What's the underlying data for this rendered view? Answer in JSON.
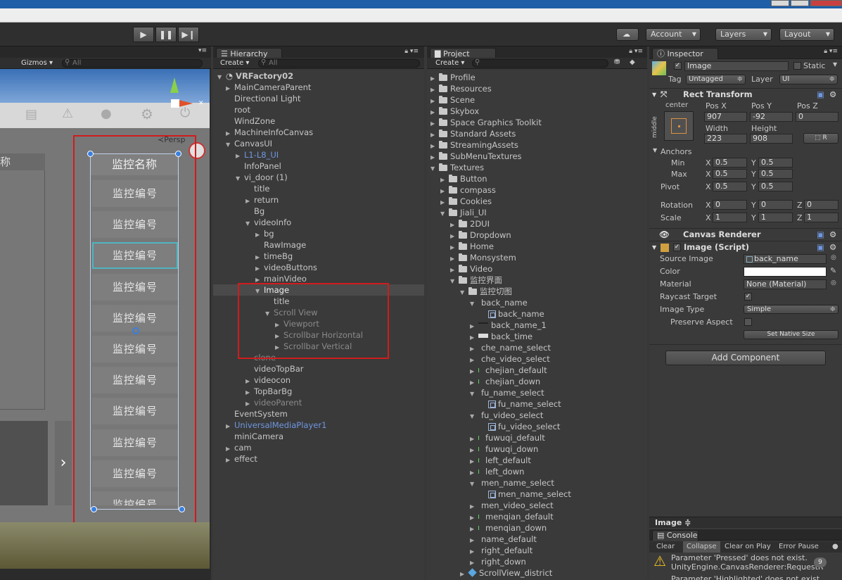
{
  "toolbar": {
    "account": "Account",
    "layers": "Layers",
    "layout": "Layout"
  },
  "scene": {
    "gizmos": "Gizmos",
    "search_placeholder": "All",
    "persp": "Persp",
    "left_header": "称",
    "panel_title": "监控名称",
    "items": [
      "监控编号",
      "监控编号",
      "监控编号",
      "监控编号",
      "监控编号",
      "监控编号",
      "监控编号",
      "监控编号",
      "监控编号",
      "监控编号",
      "监控编号"
    ]
  },
  "hierarchy": {
    "tab": "Hierarchy",
    "create": "Create",
    "search_placeholder": "All",
    "root": "VRFactory02",
    "rows": [
      {
        "label": "MainCameraParent",
        "indent": 1,
        "arrow": "▶",
        "style": ""
      },
      {
        "label": "Directional Light",
        "indent": 1,
        "arrow": "",
        "style": ""
      },
      {
        "label": "root",
        "indent": 1,
        "arrow": "",
        "style": ""
      },
      {
        "label": "WindZone",
        "indent": 1,
        "arrow": "",
        "style": ""
      },
      {
        "label": "MachineInfoCanvas",
        "indent": 1,
        "arrow": "▶",
        "style": ""
      },
      {
        "label": "CanvasUI",
        "indent": 1,
        "arrow": "▼",
        "style": ""
      },
      {
        "label": "L1-L8_UI",
        "indent": 2,
        "arrow": "▶",
        "style": "blue"
      },
      {
        "label": "InfoPanel",
        "indent": 2,
        "arrow": "",
        "style": ""
      },
      {
        "label": "vi_door (1)",
        "indent": 2,
        "arrow": "▼",
        "style": ""
      },
      {
        "label": "title",
        "indent": 3,
        "arrow": "",
        "style": ""
      },
      {
        "label": "return",
        "indent": 3,
        "arrow": "▶",
        "style": ""
      },
      {
        "label": "Bg",
        "indent": 3,
        "arrow": "",
        "style": ""
      },
      {
        "label": "videoInfo",
        "indent": 3,
        "arrow": "▼",
        "style": ""
      },
      {
        "label": "bg",
        "indent": 4,
        "arrow": "▶",
        "style": ""
      },
      {
        "label": "RawImage",
        "indent": 4,
        "arrow": "",
        "style": ""
      },
      {
        "label": "timeBg",
        "indent": 4,
        "arrow": "▶",
        "style": ""
      },
      {
        "label": "videoButtons",
        "indent": 4,
        "arrow": "▶",
        "style": ""
      },
      {
        "label": "mainVideo",
        "indent": 4,
        "arrow": "▶",
        "style": ""
      },
      {
        "label": "Image",
        "indent": 4,
        "arrow": "▼",
        "style": "sel"
      },
      {
        "label": "title",
        "indent": 5,
        "arrow": "",
        "style": ""
      },
      {
        "label": "Scroll View",
        "indent": 5,
        "arrow": "▼",
        "style": "gray"
      },
      {
        "label": "Viewport",
        "indent": 6,
        "arrow": "▶",
        "style": "gray"
      },
      {
        "label": "Scrollbar Horizontal",
        "indent": 6,
        "arrow": "▶",
        "style": "gray"
      },
      {
        "label": "Scrollbar Vertical",
        "indent": 6,
        "arrow": "▶",
        "style": "gray"
      },
      {
        "label": "clone",
        "indent": 3,
        "arrow": "",
        "style": "gray"
      },
      {
        "label": "videoTopBar",
        "indent": 3,
        "arrow": "",
        "style": ""
      },
      {
        "label": "videocon",
        "indent": 3,
        "arrow": "▶",
        "style": ""
      },
      {
        "label": "TopBarBg",
        "indent": 3,
        "arrow": "▶",
        "style": ""
      },
      {
        "label": "videoParent",
        "indent": 3,
        "arrow": "▶",
        "style": "gray"
      },
      {
        "label": "EventSystem",
        "indent": 1,
        "arrow": "",
        "style": ""
      },
      {
        "label": "UniversalMediaPlayer1",
        "indent": 1,
        "arrow": "▶",
        "style": "blue"
      },
      {
        "label": "miniCamera",
        "indent": 1,
        "arrow": "",
        "style": ""
      },
      {
        "label": "cam",
        "indent": 1,
        "arrow": "▶",
        "style": ""
      },
      {
        "label": "effect",
        "indent": 1,
        "arrow": "▶",
        "style": ""
      }
    ]
  },
  "project": {
    "tab": "Project",
    "create": "Create",
    "rows": [
      {
        "label": "Profile",
        "indent": 0,
        "arrow": "▶",
        "icon": "folder"
      },
      {
        "label": "Resources",
        "indent": 0,
        "arrow": "▶",
        "icon": "folder"
      },
      {
        "label": "Scene",
        "indent": 0,
        "arrow": "▶",
        "icon": "folder"
      },
      {
        "label": "Skybox",
        "indent": 0,
        "arrow": "▶",
        "icon": "folder"
      },
      {
        "label": "Space Graphics Toolkit",
        "indent": 0,
        "arrow": "▶",
        "icon": "folder"
      },
      {
        "label": "Standard Assets",
        "indent": 0,
        "arrow": "▶",
        "icon": "folder"
      },
      {
        "label": "StreamingAssets",
        "indent": 0,
        "arrow": "▶",
        "icon": "folder"
      },
      {
        "label": "SubMenuTextures",
        "indent": 0,
        "arrow": "▶",
        "icon": "folder"
      },
      {
        "label": "Textures",
        "indent": 0,
        "arrow": "▼",
        "icon": "folder"
      },
      {
        "label": "Button",
        "indent": 1,
        "arrow": "▶",
        "icon": "folder"
      },
      {
        "label": "compass",
        "indent": 1,
        "arrow": "▶",
        "icon": "folder"
      },
      {
        "label": "Cookies",
        "indent": 1,
        "arrow": "▶",
        "icon": "folder"
      },
      {
        "label": "Jiali_UI",
        "indent": 1,
        "arrow": "▼",
        "icon": "folder"
      },
      {
        "label": "2DUI",
        "indent": 2,
        "arrow": "▶",
        "icon": "folder"
      },
      {
        "label": "Dropdown",
        "indent": 2,
        "arrow": "▶",
        "icon": "folder"
      },
      {
        "label": "Home",
        "indent": 2,
        "arrow": "▶",
        "icon": "folder"
      },
      {
        "label": "Monsystem",
        "indent": 2,
        "arrow": "▶",
        "icon": "folder"
      },
      {
        "label": "Video",
        "indent": 2,
        "arrow": "▶",
        "icon": "folder"
      },
      {
        "label": "监控界面",
        "indent": 2,
        "arrow": "▼",
        "icon": "folder"
      },
      {
        "label": "监控切图",
        "indent": 3,
        "arrow": "▼",
        "icon": "folder"
      },
      {
        "label": "back_name",
        "indent": 4,
        "arrow": "▼",
        "icon": "none"
      },
      {
        "label": "back_name",
        "indent": 5,
        "arrow": "",
        "icon": "sprite"
      },
      {
        "label": "back_name_1",
        "indent": 4,
        "arrow": "▶",
        "icon": "dash"
      },
      {
        "label": "back_time",
        "indent": 4,
        "arrow": "▶",
        "icon": "white"
      },
      {
        "label": "che_name_select",
        "indent": 4,
        "arrow": "▶",
        "icon": "none"
      },
      {
        "label": "che_video_select",
        "indent": 4,
        "arrow": "▶",
        "icon": "none"
      },
      {
        "label": "chejian_default",
        "indent": 4,
        "arrow": "▶",
        "icon": "tick"
      },
      {
        "label": "chejian_down",
        "indent": 4,
        "arrow": "▶",
        "icon": "tick"
      },
      {
        "label": "fu_name_select",
        "indent": 4,
        "arrow": "▼",
        "icon": "none"
      },
      {
        "label": "fu_name_select",
        "indent": 5,
        "arrow": "",
        "icon": "sprite"
      },
      {
        "label": "fu_video_select",
        "indent": 4,
        "arrow": "▼",
        "icon": "none"
      },
      {
        "label": "fu_video_select",
        "indent": 5,
        "arrow": "",
        "icon": "sprite"
      },
      {
        "label": "fuwuqi_default",
        "indent": 4,
        "arrow": "▶",
        "icon": "tick"
      },
      {
        "label": "fuwuqi_down",
        "indent": 4,
        "arrow": "▶",
        "icon": "tick"
      },
      {
        "label": "left_default",
        "indent": 4,
        "arrow": "▶",
        "icon": "tick"
      },
      {
        "label": "left_down",
        "indent": 4,
        "arrow": "▶",
        "icon": "tick"
      },
      {
        "label": "men_name_select",
        "indent": 4,
        "arrow": "▼",
        "icon": "none"
      },
      {
        "label": "men_name_select",
        "indent": 5,
        "arrow": "",
        "icon": "sprite"
      },
      {
        "label": "men_video_select",
        "indent": 4,
        "arrow": "▶",
        "icon": "none"
      },
      {
        "label": "menqian_default",
        "indent": 4,
        "arrow": "▶",
        "icon": "tick"
      },
      {
        "label": "menqian_down",
        "indent": 4,
        "arrow": "▶",
        "icon": "tick"
      },
      {
        "label": "name_default",
        "indent": 4,
        "arrow": "▶",
        "icon": "none"
      },
      {
        "label": "right_default",
        "indent": 4,
        "arrow": "▶",
        "icon": "none"
      },
      {
        "label": "right_down",
        "indent": 4,
        "arrow": "▶",
        "icon": "none"
      },
      {
        "label": "ScrollView_district",
        "indent": 3,
        "arrow": "▶",
        "icon": "cube"
      }
    ]
  },
  "inspector": {
    "tab": "Inspector",
    "name": "Image",
    "static_label": "Static",
    "tag_label": "Tag",
    "tag_value": "Untagged",
    "layer_label": "Layer",
    "layer_value": "UI",
    "rect": {
      "title": "Rect Transform",
      "anchor_h": "center",
      "anchor_v": "middle",
      "posx_label": "Pos X",
      "posy_label": "Pos Y",
      "posz_label": "Pos Z",
      "posx": "907",
      "posy": "-92",
      "posz": "0",
      "width_label": "Width",
      "height_label": "Height",
      "width": "223",
      "height": "908",
      "r_label": "R",
      "anchors_label": "Anchors",
      "min_label": "Min",
      "max_label": "Max",
      "pivot_label": "Pivot",
      "x": "X",
      "y": "Y",
      "z": "Z",
      "min_x": "0.5",
      "min_y": "0.5",
      "max_x": "0.5",
      "max_y": "0.5",
      "pivot_x": "0.5",
      "pivot_y": "0.5",
      "rotation_label": "Rotation",
      "rot_x": "0",
      "rot_y": "0",
      "rot_z": "0",
      "scale_label": "Scale",
      "scale_x": "1",
      "scale_y": "1",
      "scale_z": "1"
    },
    "canvas_renderer": "Canvas Renderer",
    "image_script": {
      "title": "Image (Script)",
      "source_label": "Source Image",
      "source_value": "back_name",
      "color_label": "Color",
      "material_label": "Material",
      "material_value": "None (Material)",
      "raycast_label": "Raycast Target",
      "image_type_label": "Image Type",
      "image_type_value": "Simple",
      "preserve_label": "Preserve Aspect",
      "set_native": "Set Native Size"
    },
    "add_component": "Add Component",
    "preview_label": "Image ≑"
  },
  "console": {
    "tab": "Console",
    "clear": "Clear",
    "collapse": "Collapse",
    "clear_on_play": "Clear on Play",
    "error_pause": "Error Pause",
    "count": "9",
    "msg1": "Parameter 'Pressed' does not exist.",
    "msg2": "UnityEngine.CanvasRenderer:RequestR",
    "msg3": "Parameter 'Highlighted' does not exist."
  },
  "colors": {
    "selection_box": "#d01c1c",
    "accent_blue": "#6f97e0"
  }
}
